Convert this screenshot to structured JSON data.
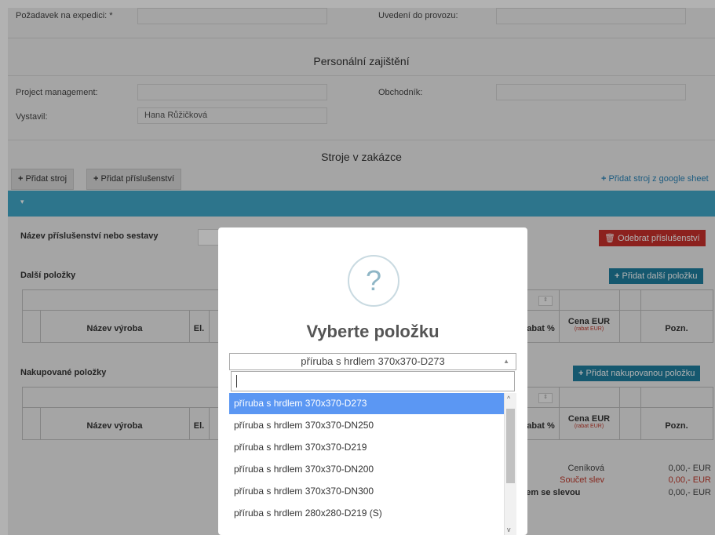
{
  "form": {
    "pozadavek_label": "Požadavek na expedici: *",
    "uvedeni_label": "Uvedení do provozu:",
    "personal_title": "Personální zajištění",
    "pm_label": "Project management:",
    "obchodnik_label": "Obchodník:",
    "vystavil_label": "Vystavil:",
    "vystavil_value": "Hana Růžičková",
    "stroje_title": "Stroje v zakázce"
  },
  "tabs": {
    "pridat_stroj": "Přidat stroj",
    "pridat_prislusenstvi": "Přidat příslušenství",
    "google_sheet": "Přidat stroj z google sheet"
  },
  "panel": {
    "nazev_label": "Název příslušenství nebo sestavy",
    "odebrat_btn": "Odebrat příslušenství",
    "dalsi_polozky": "Další položky",
    "pridat_dalsi": "Přidat další položku",
    "nakupovane": "Nakupované položky",
    "pridat_nakupovanou": "Přidat nakupovanou položku",
    "table": {
      "nazev_vyroba": "Název výroba",
      "el": "El.",
      "rabat": "abat %",
      "cena": "Cena EUR",
      "cena_sub": "(rabat EUR)",
      "pozn": "Pozn."
    },
    "summary": {
      "cenikova_label": "Ceníková",
      "cenikova_value": "0,00,- EUR",
      "soucet_label": "Součet slev",
      "soucet_value": "0,00,- EUR",
      "celkem_label": "elkem se slevou",
      "celkem_value": "0,00,- EUR"
    }
  },
  "modal": {
    "icon": "?",
    "title": "Vyberte položku",
    "selected": "příruba s hrdlem 370x370-D273",
    "search_value": "",
    "options": [
      "příruba s hrdlem 370x370-D273",
      "příruba s hrdlem 370x370-DN250",
      "příruba s hrdlem 370x370-D219",
      "příruba s hrdlem 370x370-DN200",
      "příruba s hrdlem 370x370-DN300",
      "příruba s hrdlem 280x280-D219 (S)"
    ]
  },
  "colors": {
    "accent_blue": "#41a8c9",
    "danger": "#c9302c",
    "teal_button": "#1f7fa0",
    "highlight": "#5b97f3"
  }
}
